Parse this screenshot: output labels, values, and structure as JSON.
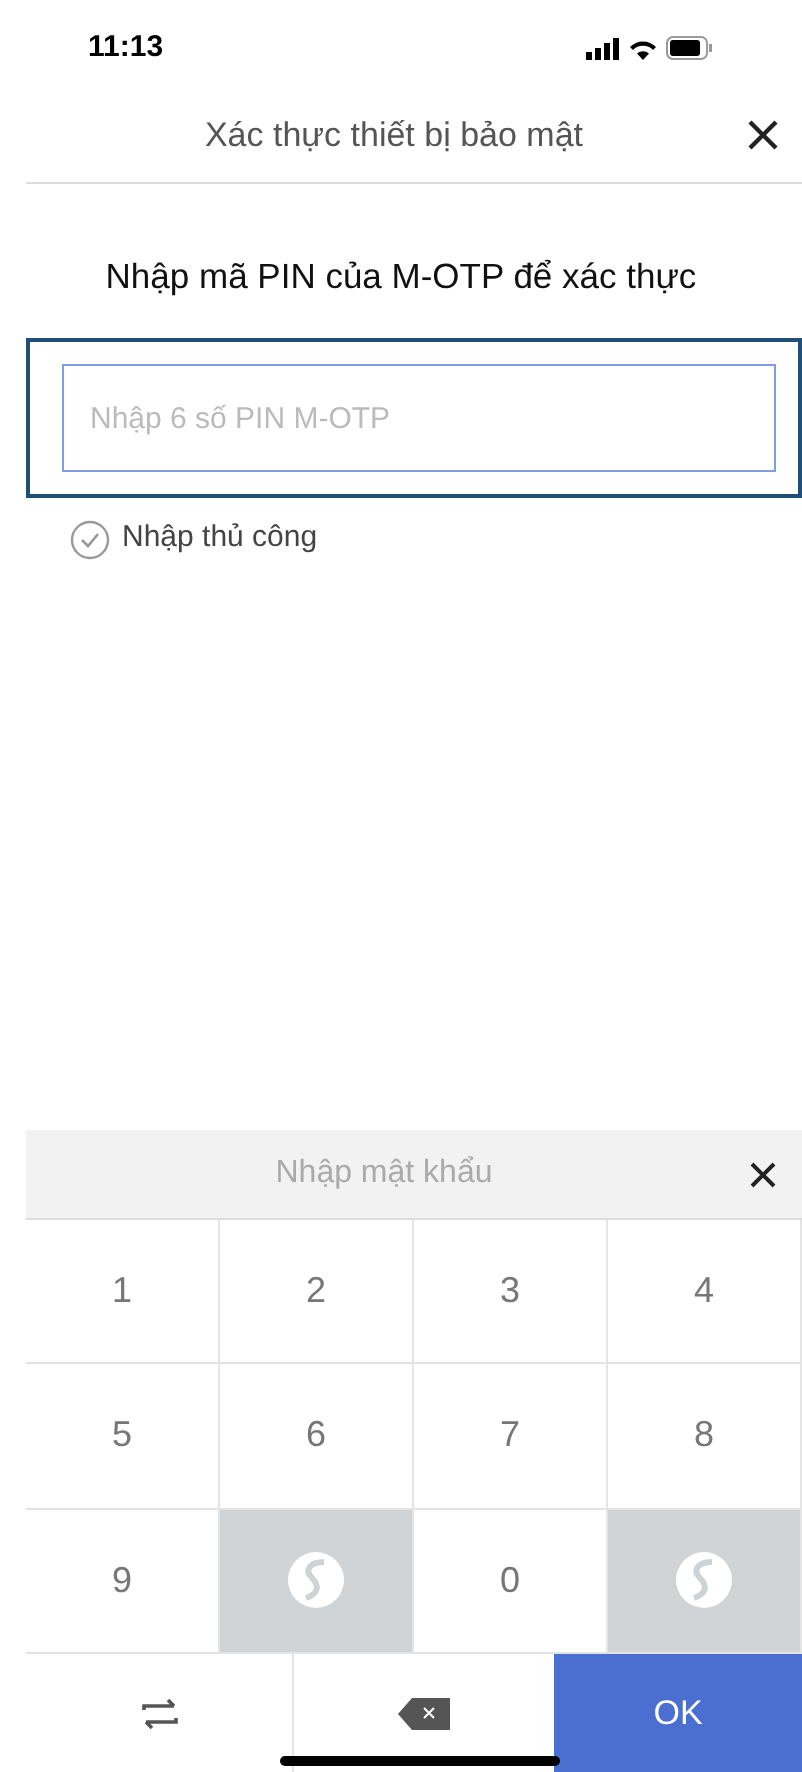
{
  "status_bar": {
    "time": "11:13"
  },
  "header": {
    "title": "Xác thực thiết bị bảo mật"
  },
  "prompt": "Nhập mã PIN của M-OTP để xác thực",
  "pin_field": {
    "placeholder": "Nhập 6 số PIN M-OTP",
    "focused": true
  },
  "manual_entry": {
    "label": "Nhập thủ công",
    "checked": false
  },
  "keypad": {
    "title": "Nhập mật khẩu",
    "keys": [
      {
        "kind": "digit",
        "label": "1"
      },
      {
        "kind": "digit",
        "label": "2"
      },
      {
        "kind": "digit",
        "label": "3"
      },
      {
        "kind": "digit",
        "label": "4"
      },
      {
        "kind": "digit",
        "label": "5"
      },
      {
        "kind": "digit",
        "label": "6"
      },
      {
        "kind": "digit",
        "label": "7"
      },
      {
        "kind": "digit",
        "label": "8"
      },
      {
        "kind": "digit",
        "label": "9"
      },
      {
        "kind": "logo"
      },
      {
        "kind": "digit",
        "label": "0"
      },
      {
        "kind": "logo"
      }
    ],
    "ok_label": "OK"
  }
}
